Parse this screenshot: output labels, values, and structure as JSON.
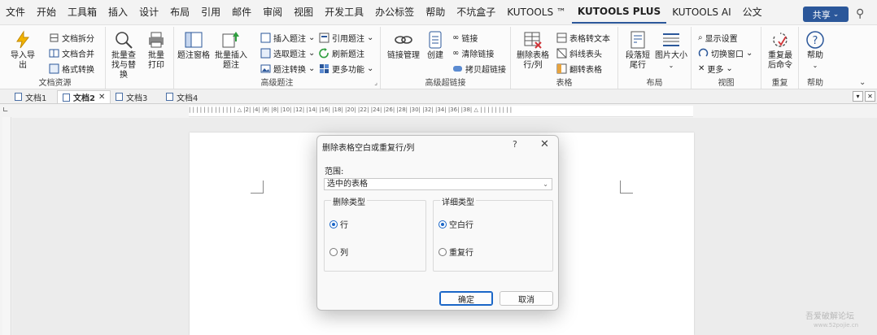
{
  "menubar": {
    "items": [
      "文件",
      "开始",
      "工具箱",
      "插入",
      "设计",
      "布局",
      "引用",
      "邮件",
      "审阅",
      "视图",
      "开发工具",
      "办公标签",
      "帮助",
      "不坑盒子",
      "KUTOOLS ™",
      "KUTOOLS PLUS",
      "KUTOOLS AI",
      "公文"
    ],
    "active_index": 15,
    "share_label": "共享"
  },
  "ribbon": {
    "groups": {
      "doc_resources": {
        "label": "文档资源",
        "import_export": "导入导出",
        "split": "文档拆分",
        "merge": "文档合并",
        "convert": "格式转换"
      },
      "batch": {
        "find_replace": "批量查找与替换",
        "print": "批量打印"
      },
      "caption": {
        "label": "高级题注",
        "window": "题注窗格",
        "batch_insert": "批量插入题注",
        "insert": "插入题注",
        "select": "选取题注",
        "convert": "题注转换",
        "cite": "引用题注",
        "refresh": "刷新题注",
        "more": "更多功能"
      },
      "hyperlink": {
        "label": "高级超链接",
        "manage": "链接管理",
        "create": "创建",
        "link": "链接",
        "clear": "清除链接",
        "copy": "拷贝超链接"
      },
      "table": {
        "label": "表格",
        "delete_blank": "删除表格行/列",
        "to_text": "表格转文本",
        "diagonal": "斜线表头",
        "flip": "翻转表格"
      },
      "layout": {
        "label": "布局",
        "paragraph": "段落短尾行",
        "image_size": "图片大小"
      },
      "view": {
        "label": "视图",
        "show_settings": "显示设置",
        "switch_window": "切换窗口",
        "more": "更多"
      },
      "repeat": {
        "label": "重复",
        "repeat_last": "重复最后命令"
      },
      "help": {
        "label": "帮助",
        "help": "帮助"
      }
    }
  },
  "tabs": [
    {
      "label": "文档1",
      "active": false
    },
    {
      "label": "文档2",
      "active": true
    },
    {
      "label": "文档3",
      "active": false
    },
    {
      "label": "文档4",
      "active": false
    }
  ],
  "ruler": {
    "text": "| | | | | | | | | | | | |  △  |2| |4| |6| |8| |10| |12| |14| |16| |18| |20| |22| |24| |26| |28| |30| |32| |34| |36| |38|  △ | | | | | | | | |"
  },
  "dialog": {
    "title": "删除表格空白或重复行/列",
    "help": "?",
    "close": "✕",
    "range_label": "范围:",
    "range_value": "选中的表格",
    "delete_type": {
      "legend": "删除类型",
      "options": [
        "行",
        "列"
      ],
      "selected": 0
    },
    "detail_type": {
      "legend": "详细类型",
      "options": [
        "空白行",
        "重复行"
      ],
      "selected": 0
    },
    "ok": "确定",
    "cancel": "取消"
  },
  "watermark": {
    "line1": "吾爱破解论坛",
    "line2": "www.52pojie.cn"
  },
  "colors": {
    "accent": "#2b579a",
    "radio": "#1a66c7"
  }
}
